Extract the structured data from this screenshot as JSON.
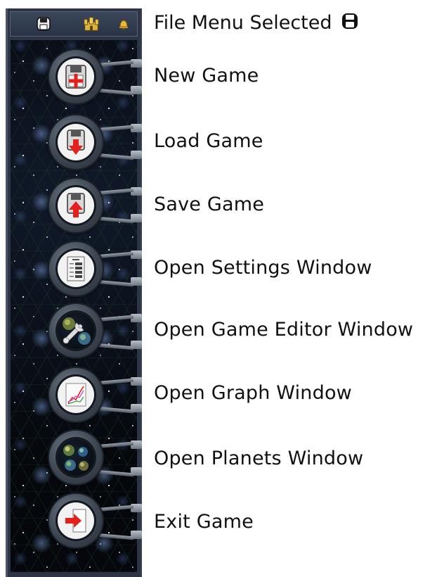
{
  "header": {
    "title": "File Menu Selected",
    "title_icon": "floppy-disk-icon",
    "toolbar_icons": [
      "floppy-disk-icon",
      "castle-icon",
      "bell-icon"
    ]
  },
  "menu": {
    "items": [
      {
        "label": "New Game",
        "icon": "new-game-icon"
      },
      {
        "label": "Load Game",
        "icon": "load-game-icon"
      },
      {
        "label": "Save Game",
        "icon": "save-game-icon"
      },
      {
        "label": "Open Settings Window",
        "icon": "settings-document-icon"
      },
      {
        "label": "Open Game Editor Window",
        "icon": "wrench-planet-icon"
      },
      {
        "label": "Open Graph Window",
        "icon": "graph-icon"
      },
      {
        "label": "Open Planets Window",
        "icon": "planets-icon"
      },
      {
        "label": "Exit Game",
        "icon": "exit-door-icon"
      }
    ]
  },
  "colors": {
    "accent_red": "#e3201b",
    "panel": "#2d3444",
    "space": "#05070c"
  }
}
